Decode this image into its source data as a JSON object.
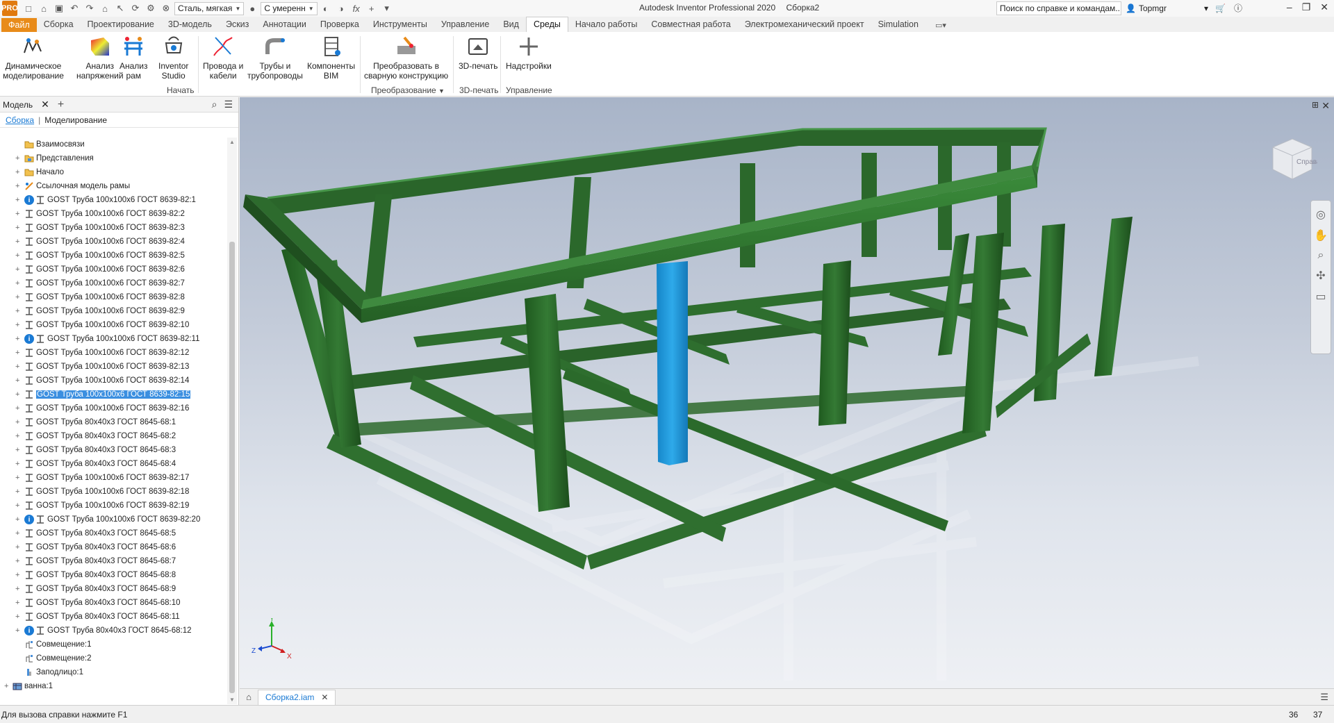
{
  "titlebar": {
    "app_logo": "PRO",
    "material": "Сталь, мягкая",
    "appearance": "С умеренн",
    "app_name": "Autodesk Inventor Professional 2020",
    "document": "Сборка2",
    "search_placeholder": "Поиск по справке и командам...",
    "user": "Topmgr"
  },
  "ribbon_tabs": [
    "Файл",
    "Сборка",
    "Проектирование",
    "3D-модель",
    "Эскиз",
    "Аннотации",
    "Проверка",
    "Инструменты",
    "Управление",
    "Вид",
    "Среды",
    "Начало работы",
    "Совместная работа",
    "Электромеханический проект",
    "Simulation"
  ],
  "ribbon_active_tab": "Среды",
  "ribbon": {
    "buttons": [
      {
        "label1": "Динамическое",
        "label2": "моделирование",
        "icon": "dynamic-simulation-icon"
      },
      {
        "label1": "Анализ",
        "label2": "напряжений",
        "icon": "stress-analysis-icon"
      },
      {
        "label1": "Анализ",
        "label2": "рам",
        "icon": "frame-analysis-icon"
      },
      {
        "label1": "Inventor",
        "label2": "Studio",
        "icon": "studio-icon"
      },
      {
        "label1": "Провода и",
        "label2": "кабели",
        "icon": "cable-icon"
      },
      {
        "label1": "Трубы и",
        "label2": "трубопроводы",
        "icon": "tube-pipe-icon"
      },
      {
        "label1": "Компоненты",
        "label2": "BIM",
        "icon": "bim-icon"
      },
      {
        "label1": "Преобразовать в",
        "label2": "сварную конструкцию",
        "icon": "weldment-icon"
      },
      {
        "label1": "3D-печать",
        "label2": "",
        "icon": "3d-print-icon"
      },
      {
        "label1": "Надстройки",
        "label2": "",
        "icon": "addins-icon"
      }
    ],
    "groups": {
      "start": "Начать",
      "convert": "Преобразование",
      "print": "3D-печать",
      "manage": "Управление"
    }
  },
  "browser": {
    "title": "Модель",
    "tab_assembly": "Сборка",
    "tab_modeling": "Моделирование",
    "items": [
      {
        "label": "Взаимосвязи",
        "type": "folder",
        "indent": 1,
        "expand": false,
        "info": false
      },
      {
        "label": "Представления",
        "type": "folder-views",
        "indent": 1,
        "expand": true,
        "info": false
      },
      {
        "label": "Начало",
        "type": "folder",
        "indent": 1,
        "expand": true,
        "info": false
      },
      {
        "label": "Ссылочная модель рамы",
        "type": "frame-ref",
        "indent": 1,
        "expand": true,
        "info": false
      },
      {
        "label": "GOST Труба 100x100x6 ГОСТ 8639-82:1",
        "type": "part",
        "indent": 1,
        "expand": true,
        "info": true
      },
      {
        "label": "GOST Труба 100x100x6 ГОСТ 8639-82:2",
        "type": "part",
        "indent": 1,
        "expand": true,
        "info": false
      },
      {
        "label": "GOST Труба 100x100x6 ГОСТ 8639-82:3",
        "type": "part",
        "indent": 1,
        "expand": true,
        "info": false
      },
      {
        "label": "GOST Труба 100x100x6 ГОСТ 8639-82:4",
        "type": "part",
        "indent": 1,
        "expand": true,
        "info": false
      },
      {
        "label": "GOST Труба 100x100x6 ГОСТ 8639-82:5",
        "type": "part",
        "indent": 1,
        "expand": true,
        "info": false
      },
      {
        "label": "GOST Труба 100x100x6 ГОСТ 8639-82:6",
        "type": "part",
        "indent": 1,
        "expand": true,
        "info": false
      },
      {
        "label": "GOST Труба 100x100x6 ГОСТ 8639-82:7",
        "type": "part",
        "indent": 1,
        "expand": true,
        "info": false
      },
      {
        "label": "GOST Труба 100x100x6 ГОСТ 8639-82:8",
        "type": "part",
        "indent": 1,
        "expand": true,
        "info": false
      },
      {
        "label": "GOST Труба 100x100x6 ГОСТ 8639-82:9",
        "type": "part",
        "indent": 1,
        "expand": true,
        "info": false
      },
      {
        "label": "GOST Труба 100x100x6 ГОСТ 8639-82:10",
        "type": "part",
        "indent": 1,
        "expand": true,
        "info": false
      },
      {
        "label": "GOST Труба 100x100x6 ГОСТ 8639-82:11",
        "type": "part",
        "indent": 1,
        "expand": true,
        "info": true
      },
      {
        "label": "GOST Труба 100x100x6 ГОСТ 8639-82:12",
        "type": "part",
        "indent": 1,
        "expand": true,
        "info": false
      },
      {
        "label": "GOST Труба 100x100x6 ГОСТ 8639-82:13",
        "type": "part",
        "indent": 1,
        "expand": true,
        "info": false
      },
      {
        "label": "GOST Труба 100x100x6 ГОСТ 8639-82:14",
        "type": "part",
        "indent": 1,
        "expand": true,
        "info": false
      },
      {
        "label": "GOST Труба 100x100x6 ГОСТ 8639-82:15",
        "type": "part",
        "indent": 1,
        "expand": true,
        "info": false,
        "selected": true
      },
      {
        "label": "GOST Труба 100x100x6 ГОСТ 8639-82:16",
        "type": "part",
        "indent": 1,
        "expand": true,
        "info": false
      },
      {
        "label": "GOST Труба 80x40x3 ГОСТ 8645-68:1",
        "type": "part",
        "indent": 1,
        "expand": true,
        "info": false
      },
      {
        "label": "GOST Труба 80x40x3 ГОСТ 8645-68:2",
        "type": "part",
        "indent": 1,
        "expand": true,
        "info": false
      },
      {
        "label": "GOST Труба 80x40x3 ГОСТ 8645-68:3",
        "type": "part",
        "indent": 1,
        "expand": true,
        "info": false
      },
      {
        "label": "GOST Труба 80x40x3 ГОСТ 8645-68:4",
        "type": "part",
        "indent": 1,
        "expand": true,
        "info": false
      },
      {
        "label": "GOST Труба 100x100x6 ГОСТ 8639-82:17",
        "type": "part",
        "indent": 1,
        "expand": true,
        "info": false
      },
      {
        "label": "GOST Труба 100x100x6 ГОСТ 8639-82:18",
        "type": "part",
        "indent": 1,
        "expand": true,
        "info": false
      },
      {
        "label": "GOST Труба 100x100x6 ГОСТ 8639-82:19",
        "type": "part",
        "indent": 1,
        "expand": true,
        "info": false
      },
      {
        "label": "GOST Труба 100x100x6 ГОСТ 8639-82:20",
        "type": "part",
        "indent": 1,
        "expand": true,
        "info": true
      },
      {
        "label": "GOST Труба 80x40x3 ГОСТ 8645-68:5",
        "type": "part",
        "indent": 1,
        "expand": true,
        "info": false
      },
      {
        "label": "GOST Труба 80x40x3 ГОСТ 8645-68:6",
        "type": "part",
        "indent": 1,
        "expand": true,
        "info": false
      },
      {
        "label": "GOST Труба 80x40x3 ГОСТ 8645-68:7",
        "type": "part",
        "indent": 1,
        "expand": true,
        "info": false
      },
      {
        "label": "GOST Труба 80x40x3 ГОСТ 8645-68:8",
        "type": "part",
        "indent": 1,
        "expand": true,
        "info": false
      },
      {
        "label": "GOST Труба 80x40x3 ГОСТ 8645-68:9",
        "type": "part",
        "indent": 1,
        "expand": true,
        "info": false
      },
      {
        "label": "GOST Труба 80x40x3 ГОСТ 8645-68:10",
        "type": "part",
        "indent": 1,
        "expand": true,
        "info": false
      },
      {
        "label": "GOST Труба 80x40x3 ГОСТ 8645-68:11",
        "type": "part",
        "indent": 1,
        "expand": true,
        "info": false
      },
      {
        "label": "GOST Труба 80x40x3 ГОСТ 8645-68:12",
        "type": "part",
        "indent": 1,
        "expand": true,
        "info": true
      },
      {
        "label": "Совмещение:1",
        "type": "constraint",
        "indent": 1,
        "expand": false,
        "info": false
      },
      {
        "label": "Совмещение:2",
        "type": "constraint",
        "indent": 1,
        "expand": false,
        "info": false
      },
      {
        "label": "Заподлицо:1",
        "type": "constraint-flush",
        "indent": 1,
        "expand": false,
        "info": false
      },
      {
        "label": "ванна:1",
        "type": "subassembly",
        "indent": 0,
        "expand": true,
        "info": false
      }
    ]
  },
  "viewcube": {
    "label": "Справа"
  },
  "triad": {
    "x": "X",
    "y": "Y",
    "z": "Z"
  },
  "doc_tabs": [
    {
      "label": "Сборка2.iam"
    }
  ],
  "status": {
    "hint": "Для вызова справки нажмите F1",
    "count1": "36",
    "count2": "37"
  },
  "colors": {
    "frame": "#2d6b2d",
    "frame_dark": "#1f4f1f",
    "frame_light": "#3f8a3f",
    "selected": "#1ea0e0",
    "ribbon_file": "#e88b1a",
    "accent": "#1a7ad4"
  }
}
